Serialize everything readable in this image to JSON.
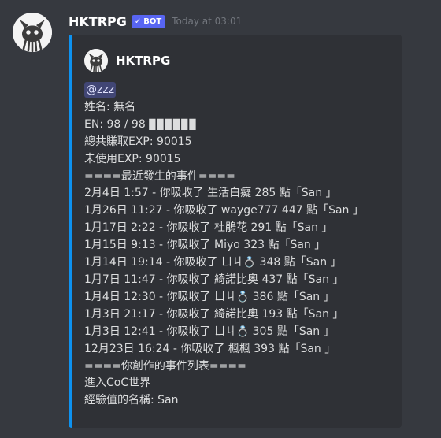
{
  "message": {
    "username": "HKTRPG",
    "bot_tag": "BOT",
    "timestamp": "Today at 03:01"
  },
  "embed": {
    "author_name": "HKTRPG",
    "accent_color": "#0d92f0",
    "mention": "@zzz",
    "name_line": "姓名: 無名",
    "en_line": "EN: 98 / 98",
    "en_blocks": "▉▉▉▉▉▉",
    "total_exp_line": "總共賺取EXP: 90015",
    "unused_exp_line": "未使用EXP: 90015",
    "recent_events_header": "====最近發生的事件====",
    "events": [
      {
        "prefix": "2月4日 1:57 - 你吸收了 生活白癡 285 點「San 」"
      },
      {
        "prefix": "1月26日 11:27 - 你吸收了 wayge777 447 點「San 」"
      },
      {
        "prefix": "1月17日 2:22 - 你吸收了 杜鵑花 291 點「San 」"
      },
      {
        "prefix": "1月15日 9:13 - 你吸收了 Miyo 323 點「San 」"
      },
      {
        "prefix": "1月14日 19:14 - 你吸收了 ㄩㄐ",
        "emoji": "ring-icon",
        "suffix": " 348 點「San 」"
      },
      {
        "prefix": "1月7日 11:47 - 你吸收了 綺諾比奧 437 點「San 」"
      },
      {
        "prefix": "1月4日 12:30 - 你吸收了 ㄩㄐ",
        "emoji": "ring-icon",
        "suffix": " 386 點「San 」"
      },
      {
        "prefix": "1月3日 21:17 - 你吸收了 綺諾比奧 193 點「San 」"
      },
      {
        "prefix": "1月3日 12:41 - 你吸收了 ㄩㄐ",
        "emoji": "ring-icon",
        "suffix": " 305 點「San 」"
      },
      {
        "prefix": "12月23日 16:24 - 你吸收了 楓楓 393 點「San 」"
      }
    ],
    "created_events_header": "====你創作的事件列表====",
    "world_line": "進入CoC世界",
    "exp_name_line": "經驗值的名稱: San"
  }
}
